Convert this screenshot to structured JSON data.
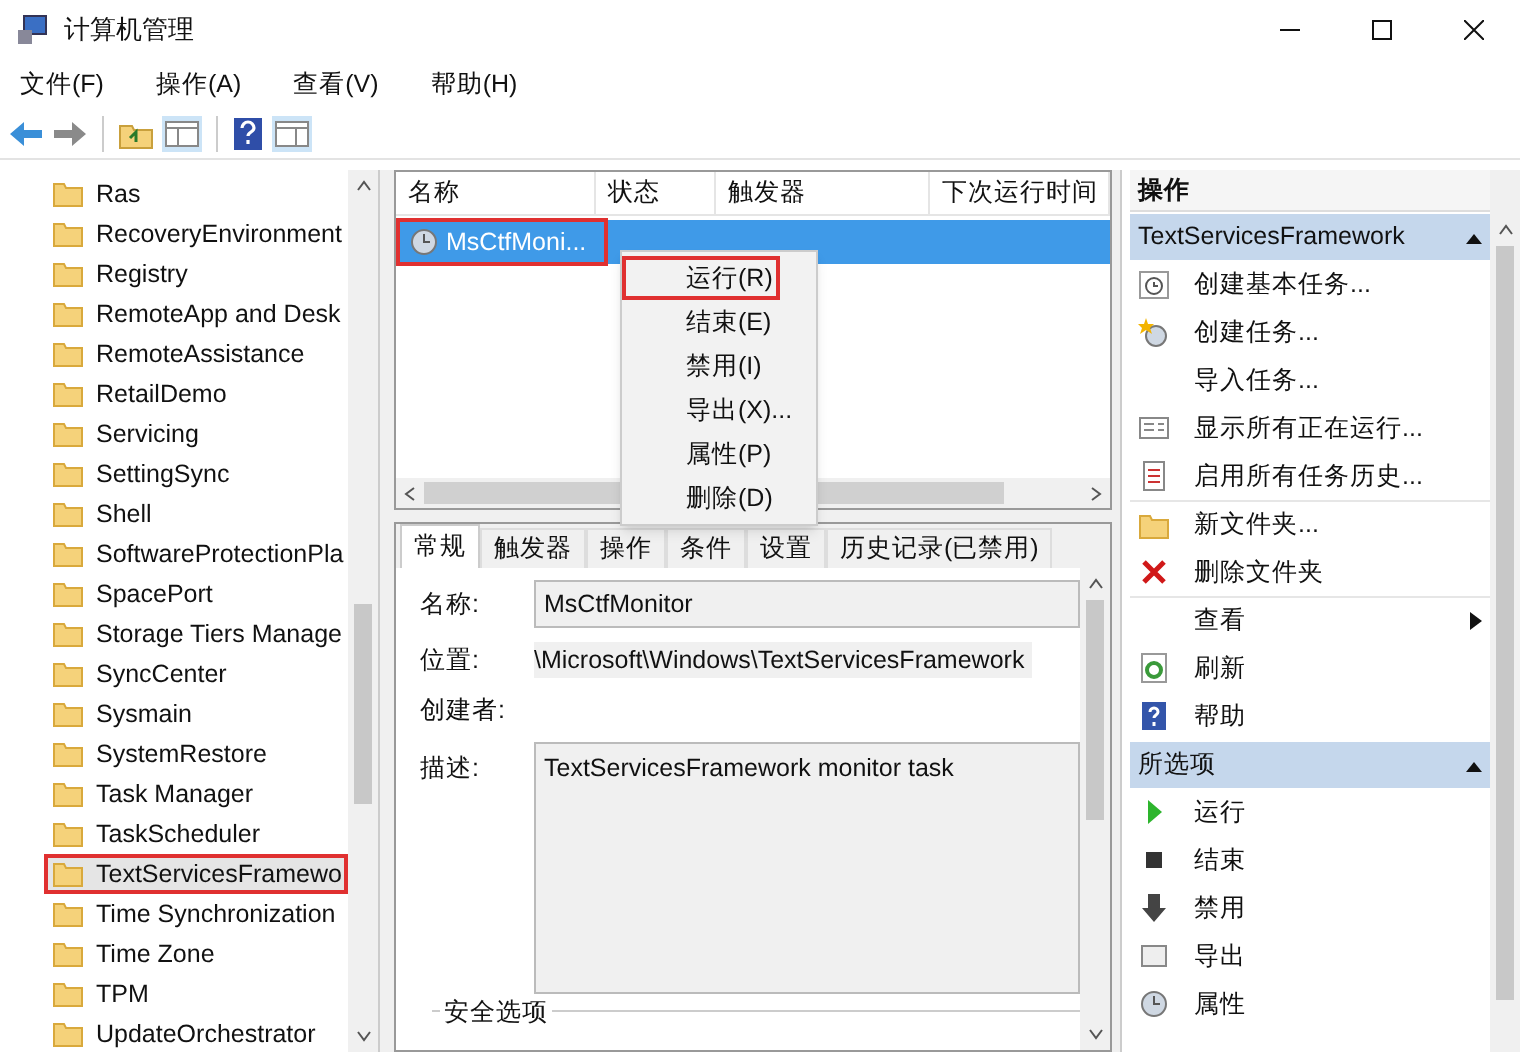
{
  "window": {
    "title": "计算机管理"
  },
  "menu_bar": [
    "文件(F)",
    "操作(A)",
    "查看(V)",
    "帮助(H)"
  ],
  "tree": {
    "items": [
      {
        "label": "Ras",
        "selected": false,
        "highlighted": false
      },
      {
        "label": "RecoveryEnvironment",
        "selected": false,
        "highlighted": false
      },
      {
        "label": "Registry",
        "selected": false,
        "highlighted": false
      },
      {
        "label": "RemoteApp and Desk",
        "selected": false,
        "highlighted": false
      },
      {
        "label": "RemoteAssistance",
        "selected": false,
        "highlighted": false
      },
      {
        "label": "RetailDemo",
        "selected": false,
        "highlighted": false
      },
      {
        "label": "Servicing",
        "selected": false,
        "highlighted": false
      },
      {
        "label": "SettingSync",
        "selected": false,
        "highlighted": false
      },
      {
        "label": "Shell",
        "selected": false,
        "highlighted": false
      },
      {
        "label": "SoftwareProtectionPla",
        "selected": false,
        "highlighted": false
      },
      {
        "label": "SpacePort",
        "selected": false,
        "highlighted": false
      },
      {
        "label": "Storage Tiers Manage",
        "selected": false,
        "highlighted": false
      },
      {
        "label": "SyncCenter",
        "selected": false,
        "highlighted": false
      },
      {
        "label": "Sysmain",
        "selected": false,
        "highlighted": false
      },
      {
        "label": "SystemRestore",
        "selected": false,
        "highlighted": false
      },
      {
        "label": "Task Manager",
        "selected": false,
        "highlighted": false
      },
      {
        "label": "TaskScheduler",
        "selected": false,
        "highlighted": false
      },
      {
        "label": "TextServicesFramewo",
        "selected": true,
        "highlighted": true
      },
      {
        "label": "Time Synchronization",
        "selected": false,
        "highlighted": false
      },
      {
        "label": "Time Zone",
        "selected": false,
        "highlighted": false
      },
      {
        "label": "TPM",
        "selected": false,
        "highlighted": false
      },
      {
        "label": "UpdateOrchestrator",
        "selected": false,
        "highlighted": false
      }
    ]
  },
  "task_table": {
    "columns": [
      "名称",
      "状态",
      "触发器",
      "下次运行时间"
    ],
    "rows": [
      {
        "name": "MsCtfMoni...",
        "selected": true,
        "highlighted": true
      }
    ]
  },
  "context_menu": {
    "items": [
      {
        "label": "运行(R)",
        "highlighted": true
      },
      {
        "label": "结束(E)",
        "highlighted": false
      },
      {
        "label": "禁用(I)",
        "highlighted": false
      },
      {
        "label": "导出(X)...",
        "highlighted": false
      },
      {
        "label": "属性(P)",
        "highlighted": false
      },
      {
        "label": "删除(D)",
        "highlighted": false
      }
    ]
  },
  "detail_tabs": [
    {
      "label": "常规",
      "selected": true
    },
    {
      "label": "触发器",
      "selected": false
    },
    {
      "label": "操作",
      "selected": false
    },
    {
      "label": "条件",
      "selected": false
    },
    {
      "label": "设置",
      "selected": false
    },
    {
      "label": "历史记录(已禁用)",
      "selected": false
    }
  ],
  "general": {
    "name_label": "名称:",
    "name_value": "MsCtfMonitor",
    "location_label": "位置:",
    "location_value": "\\Microsoft\\Windows\\TextServicesFramework",
    "author_label": "创建者:",
    "description_label": "描述:",
    "description_value": "TextServicesFramework monitor task",
    "security_group": "安全选项"
  },
  "actions_pane": {
    "title": "操作",
    "sections": [
      {
        "title": "TextServicesFramework",
        "expanded": true,
        "items": [
          {
            "label": "创建基本任务...",
            "submenu": false
          },
          {
            "label": "创建任务...",
            "submenu": false
          },
          {
            "label": "导入任务...",
            "submenu": false
          },
          {
            "label": "显示所有正在运行...",
            "submenu": false
          },
          {
            "label": "启用所有任务历史...",
            "submenu": false
          },
          {
            "label": "新文件夹...",
            "submenu": false
          },
          {
            "label": "删除文件夹",
            "submenu": false
          },
          {
            "label": "查看",
            "submenu": true
          },
          {
            "label": "刷新",
            "submenu": false
          },
          {
            "label": "帮助",
            "submenu": false
          }
        ]
      },
      {
        "title": "所选项",
        "expanded": true,
        "items": [
          {
            "label": "运行",
            "submenu": false
          },
          {
            "label": "结束",
            "submenu": false
          },
          {
            "label": "禁用",
            "submenu": false
          },
          {
            "label": "导出",
            "submenu": false
          },
          {
            "label": "属性",
            "submenu": false
          }
        ]
      }
    ]
  }
}
